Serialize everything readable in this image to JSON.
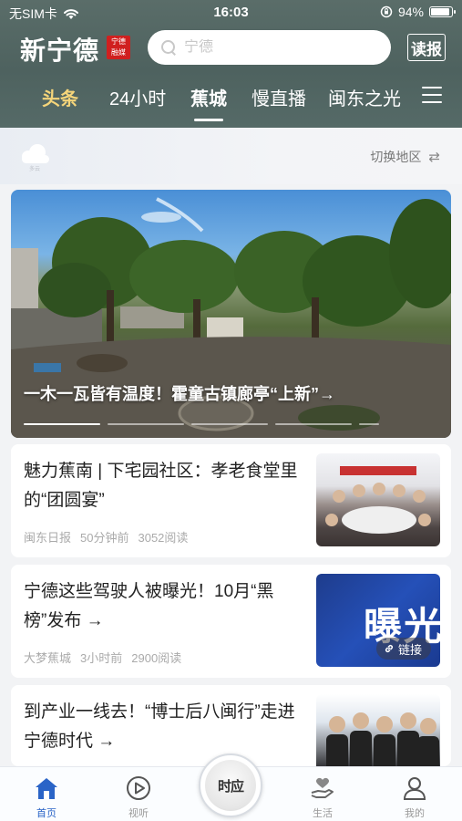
{
  "status_bar": {
    "carrier": "无SIM卡",
    "time": "16:03",
    "battery": "94%",
    "battery_level": 0.94
  },
  "header": {
    "logo": "新宁德",
    "logo_seal": "宁德融媒",
    "search_placeholder": "宁德",
    "read_button": "读报"
  },
  "tabs": [
    {
      "label": "头条"
    },
    {
      "label": "24小时"
    },
    {
      "label": "蕉城"
    },
    {
      "label": "慢直播"
    },
    {
      "label": "闽东之光"
    }
  ],
  "weather": {
    "icon": "cloud-icon",
    "cloud_label": "多云",
    "switch_region": "切换地区",
    "swap_icon": "⇄"
  },
  "hero": {
    "title": "一木一瓦皆有温度！霍童古镇廊亭“上新”→",
    "slide_count": 5,
    "active_slide": 0
  },
  "news": [
    {
      "title": "魅力蕉南 | 下宅园社区：孝老食堂里的“团圆宴”",
      "source": "闽东日报",
      "time": "50分钟前",
      "reads": "3052阅读"
    },
    {
      "title": "宁德这些驾驶人被曝光！10月“黑榜”发布 →",
      "source": "大梦蕉城",
      "time": "3小时前",
      "reads": "2900阅读",
      "thumb_text": "曝光",
      "badge": "链接"
    },
    {
      "title": "到产业一线去！“博士后八闽行”走进宁德时代 →"
    }
  ],
  "bottom_nav": {
    "items": [
      {
        "label": "首页",
        "icon": "home-icon"
      },
      {
        "label": "视听",
        "icon": "play-icon"
      },
      {
        "label": "生活",
        "icon": "heart-hand-icon"
      },
      {
        "label": "我的",
        "icon": "user-icon"
      }
    ],
    "center_label": "时应"
  },
  "colors": {
    "header_bg": "#4e625f",
    "tab_highlight": "#f5d57a",
    "nav_active": "#2a64c7"
  }
}
